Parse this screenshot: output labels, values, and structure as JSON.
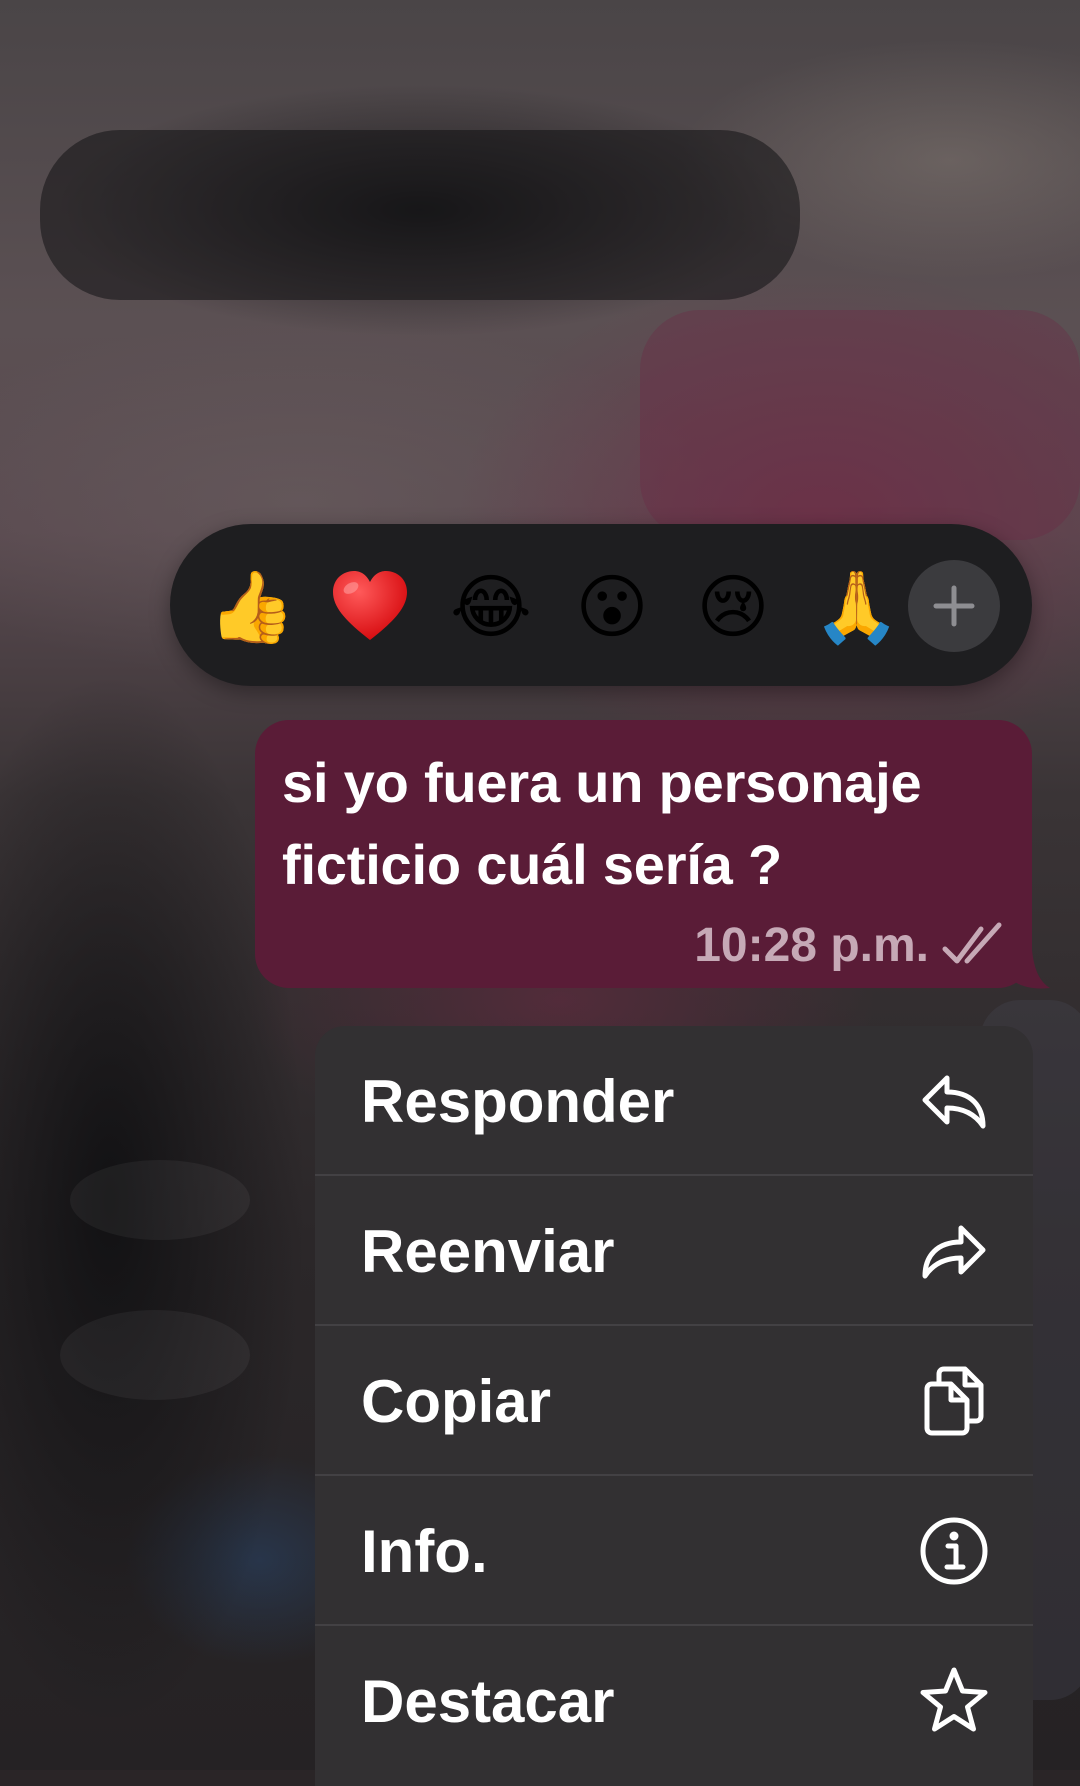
{
  "reactions": {
    "emojis": [
      {
        "icon": "thumbs-up-icon",
        "glyph": "👍"
      },
      {
        "icon": "red-heart-icon",
        "glyph": "❤"
      },
      {
        "icon": "tears-of-joy-icon",
        "glyph": "😂"
      },
      {
        "icon": "surprised-face-icon",
        "glyph": "😮"
      },
      {
        "icon": "crying-face-icon",
        "glyph": "😢"
      },
      {
        "icon": "folded-hands-icon",
        "glyph": "🙏"
      }
    ],
    "more_icon": "plus-icon"
  },
  "message": {
    "line1": "si yo fuera un personaje",
    "line2": "ficticio cuál sería ?",
    "time": "10:28 p.m.",
    "status_icon": "double-check-icon",
    "bubble_color": "#5a1c37"
  },
  "menu": {
    "items": [
      {
        "label": "Responder",
        "icon": "reply-icon"
      },
      {
        "label": "Reenviar",
        "icon": "forward-icon"
      },
      {
        "label": "Copiar",
        "icon": "copy-icon"
      },
      {
        "label": "Info.",
        "icon": "info-icon"
      },
      {
        "label": "Destacar",
        "icon": "star-icon"
      }
    ]
  }
}
